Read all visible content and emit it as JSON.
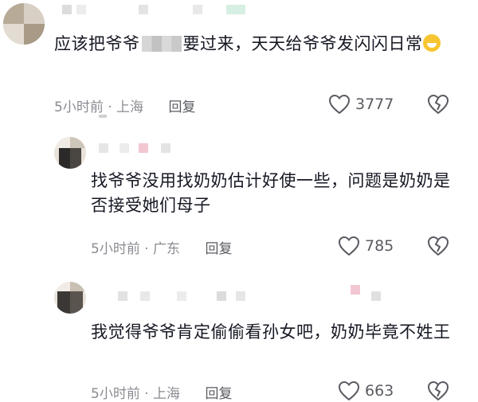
{
  "comments": [
    {
      "text_before": "应该把爷爷",
      "text_after": "要过来，天天给爷爷发闪闪日常",
      "emoji": "laughing-tears-icon",
      "time": "5小时前",
      "location": "上海",
      "reply_label": "回复",
      "likes": "3777"
    },
    {
      "text": "找爷爷没用找奶奶估计好使一些，问题是奶奶是否接受她们母子",
      "time": "5小时前",
      "location": "广东",
      "reply_label": "回复",
      "likes": "785"
    },
    {
      "text": "我觉得爷爷肯定偷偷看孙女吧，奶奶毕竟不姓王",
      "time": "5小时前",
      "location": "上海",
      "reply_label": "回复",
      "likes": "663"
    }
  ],
  "colors": {
    "text": "#161823",
    "meta": "#8a8b91",
    "icon": "#5a5b61"
  }
}
